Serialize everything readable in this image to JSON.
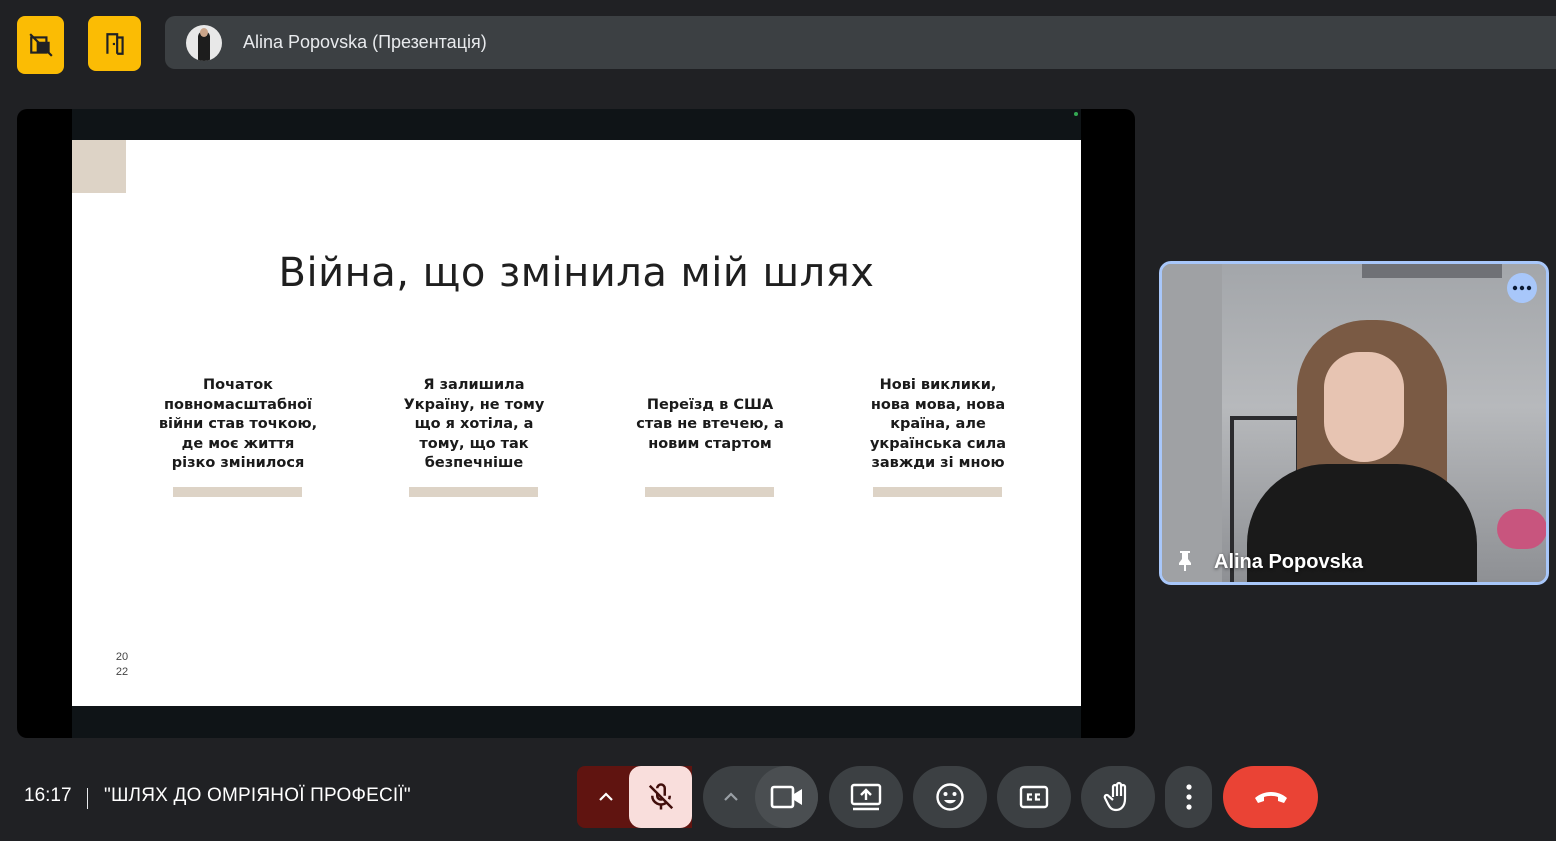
{
  "top": {
    "presenter_title": "Alina Popovska (Презентація)"
  },
  "slide": {
    "title": "Війна, що змінила мій шлях",
    "columns": [
      {
        "text": "Початок повномасштабної війни став точкою, де моє життя різко змінилося"
      },
      {
        "text": "Я залишила Україну, не тому що я хотіла, а тому, що так безпечніше"
      },
      {
        "text": "Переїзд в США став не втечею, а новим стартом"
      },
      {
        "text": "Нові виклики, нова мова, нова країна, але українська сила завжди зі мною"
      }
    ],
    "page_number_top": "20",
    "page_number_bottom": "22"
  },
  "participant": {
    "name": "Alina Popovska"
  },
  "bottom": {
    "time": "16:17",
    "meeting_title": "\"ШЛЯХ ДО ОМРІЯНОЇ ПРОФЕСІЇ\""
  },
  "icons": {
    "top_left_1": "hide-self-view-icon",
    "top_left_2": "exit-door-icon",
    "mic": "mic-off-icon",
    "camera": "videocam-icon",
    "present": "present-screen-icon",
    "reactions": "emoji-icon",
    "captions": "closed-captions-icon",
    "hand": "raise-hand-icon",
    "more": "more-vert-icon",
    "end_call": "call-end-icon"
  },
  "colors": {
    "accent_yellow": "#fbbc04",
    "end_call_red": "#ea4335",
    "mic_muted_bg": "#f9dedc",
    "mic_arrow_bg": "#601410",
    "tile_border": "#a8c7fa",
    "slide_accent": "#ddd3c6"
  }
}
